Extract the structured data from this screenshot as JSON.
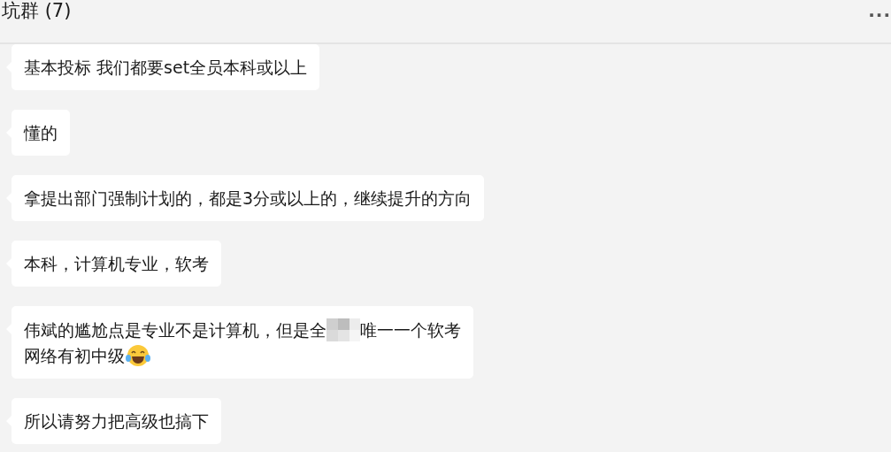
{
  "header": {
    "title": "坑群 (7)",
    "more": "..."
  },
  "messages": [
    {
      "lines": [
        [
          {
            "kind": "text",
            "text": "基本投标 我们都要set全员本科或以上"
          }
        ]
      ]
    },
    {
      "lines": [
        [
          {
            "kind": "text",
            "text": "懂的"
          }
        ]
      ]
    },
    {
      "lines": [
        [
          {
            "kind": "text",
            "text": "拿提出部门强制计划的，都是3分或以上的，继续提升的方向"
          }
        ]
      ]
    },
    {
      "lines": [
        [
          {
            "kind": "text",
            "text": "本科，计算机专业，软考"
          }
        ]
      ]
    },
    {
      "lines": [
        [
          {
            "kind": "text",
            "text": "伟斌的尴尬点是专业不是计算机，但是全"
          },
          {
            "kind": "blur"
          },
          {
            "kind": "text",
            "text": "唯一一个软考"
          }
        ],
        [
          {
            "kind": "text",
            "text": "网络有初中级"
          },
          {
            "kind": "emoji"
          }
        ]
      ]
    },
    {
      "lines": [
        [
          {
            "kind": "text",
            "text": "所以请努力把高级也搞下"
          }
        ]
      ]
    }
  ]
}
